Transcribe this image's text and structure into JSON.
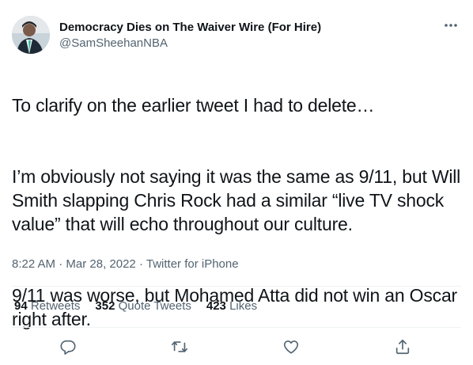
{
  "author": {
    "display_name": "Democracy Dies on The Waiver Wire (For Hire)",
    "handle": "@SamSheehanNBA"
  },
  "tweet": {
    "paragraphs": [
      "To clarify on the earlier tweet I had to delete…",
      "I’m obviously not saying it was the same as 9/11, but Will Smith slapping Chris Rock had a similar “live TV shock value” that will echo throughout our culture.",
      "9/11 was worse, but Mohamed Atta did not win an Oscar right after."
    ],
    "time": "8:22 AM",
    "separator": "·",
    "date": "Mar 28, 2022",
    "source": "Twitter for iPhone"
  },
  "stats": {
    "retweets_count": "94",
    "retweets_label": "Retweets",
    "quotes_count": "352",
    "quotes_label": "Quote Tweets",
    "likes_count": "423",
    "likes_label": "Likes"
  },
  "icons": {
    "more": "more-horizontal-icon",
    "reply": "reply-icon",
    "retweet": "retweet-icon",
    "like": "heart-icon",
    "share": "share-icon"
  },
  "colors": {
    "text": "#0f1419",
    "secondary": "#536471",
    "divider": "#eff3f4"
  }
}
